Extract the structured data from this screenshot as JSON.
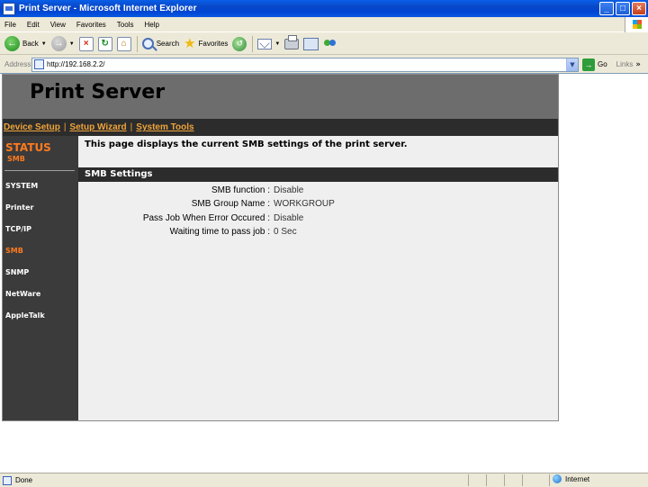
{
  "window": {
    "title": "Print Server - Microsoft Internet Explorer",
    "buttons": {
      "minimize": "_",
      "maximize": "□",
      "close": "×"
    }
  },
  "menu": [
    "File",
    "Edit",
    "View",
    "Favorites",
    "Tools",
    "Help"
  ],
  "toolbar": {
    "back_label": "Back",
    "search_label": "Search",
    "favorites_label": "Favorites"
  },
  "address": {
    "label": "Address",
    "url": "http://192.168.2.2/",
    "go_label": "Go",
    "links_label": "Links"
  },
  "page": {
    "brand": "Print Server",
    "topnav": [
      "Device Setup",
      "Setup Wizard",
      "System Tools"
    ],
    "topnav_separator": "|",
    "sidebar": {
      "title": "STATUS",
      "subtitle": "SMB",
      "items": [
        "SYSTEM",
        "Printer",
        "TCP/IP",
        "SMB",
        "SNMP",
        "NetWare",
        "AppleTalk"
      ],
      "active": "SMB"
    },
    "intro": "This page displays the current SMB settings of the print server.",
    "section_title": "SMB Settings",
    "settings": [
      {
        "label": "SMB function :",
        "value": "Disable"
      },
      {
        "label": "SMB Group Name :",
        "value": "WORKGROUP"
      },
      {
        "label": "Pass Job When Error Occured :",
        "value": "Disable"
      },
      {
        "label": "Waiting time to pass job :",
        "value": "0 Sec"
      }
    ]
  },
  "status": {
    "text": "Done",
    "zone": "Internet"
  },
  "colors": {
    "accent_orange": "#FF7A1E",
    "nav_link": "#F0A43A",
    "banner": "#6D6D6D",
    "sidebar": "#3B3B3B",
    "content_bg": "#EFEFEF"
  }
}
